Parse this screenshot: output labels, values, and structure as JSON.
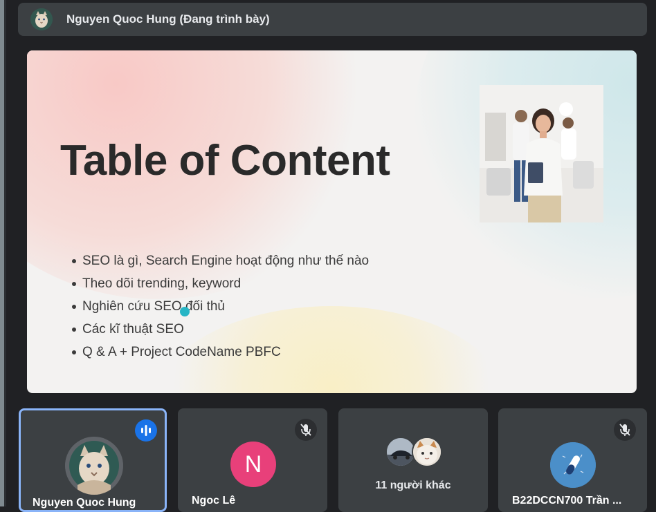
{
  "presenter_bar": {
    "name": "Nguyen Quoc Hung (Đang trình bày)",
    "avatar_icon": "cat-avatar-icon"
  },
  "slide": {
    "title": "Table of Content",
    "items": [
      "SEO là gì, Search Engine hoạt động như thế nào",
      "Theo dõi trending, keyword",
      "Nghiên cứu SEO đối thủ",
      "Các kĩ thuật SEO",
      "Q & A + Project CodeName PBFC"
    ],
    "pointer_color": "#26b5c5"
  },
  "participants": [
    {
      "name": "Nguyen Quoc Hung",
      "state": "speaking",
      "avatar": "cat-avatar-icon"
    },
    {
      "name": "Ngoc Lê",
      "state": "muted",
      "initial": "N",
      "avatar_color": "#e8407a"
    },
    {
      "label": "11 người khác"
    },
    {
      "name": "B22DCCN700 Trần ...",
      "state": "muted",
      "avatar": "pill-avatar-icon",
      "avatar_color": "#4b8fc9"
    }
  ],
  "colors": {
    "background": "#202124",
    "tile": "#3c4043",
    "active_border": "#8ab4f8",
    "speaking_badge": "#1a73e8"
  }
}
